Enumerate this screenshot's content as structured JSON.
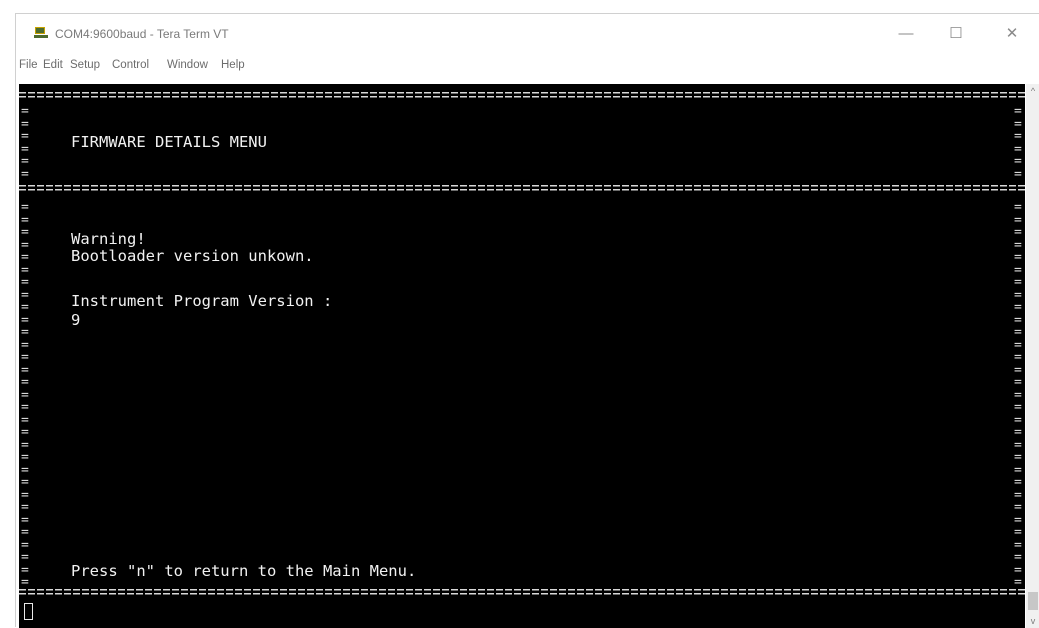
{
  "window": {
    "title": "COM4:9600baud - Tera Term VT",
    "minimize_glyph": "—",
    "maximize_glyph": "☐",
    "close_glyph": "✕",
    "icon": "teraterm-icon"
  },
  "menubar": {
    "items": [
      "File",
      "Edit",
      "Setup",
      "Control",
      "Window",
      "Help"
    ]
  },
  "terminal": {
    "heading": "FIRMWARE DETAILS MENU",
    "warning": "Warning!",
    "bootloader_msg": "Bootloader version unkown.",
    "program_label": "Instrument Program Version :",
    "program_value": "9",
    "footer": "Press \"n\" to return to the Main Menu.",
    "border_char": "="
  },
  "scrollbar": {
    "up_glyph": "^",
    "down_glyph": "v"
  },
  "colors": {
    "terminal_bg": "#000000",
    "terminal_fg": "#f2f2f2"
  }
}
